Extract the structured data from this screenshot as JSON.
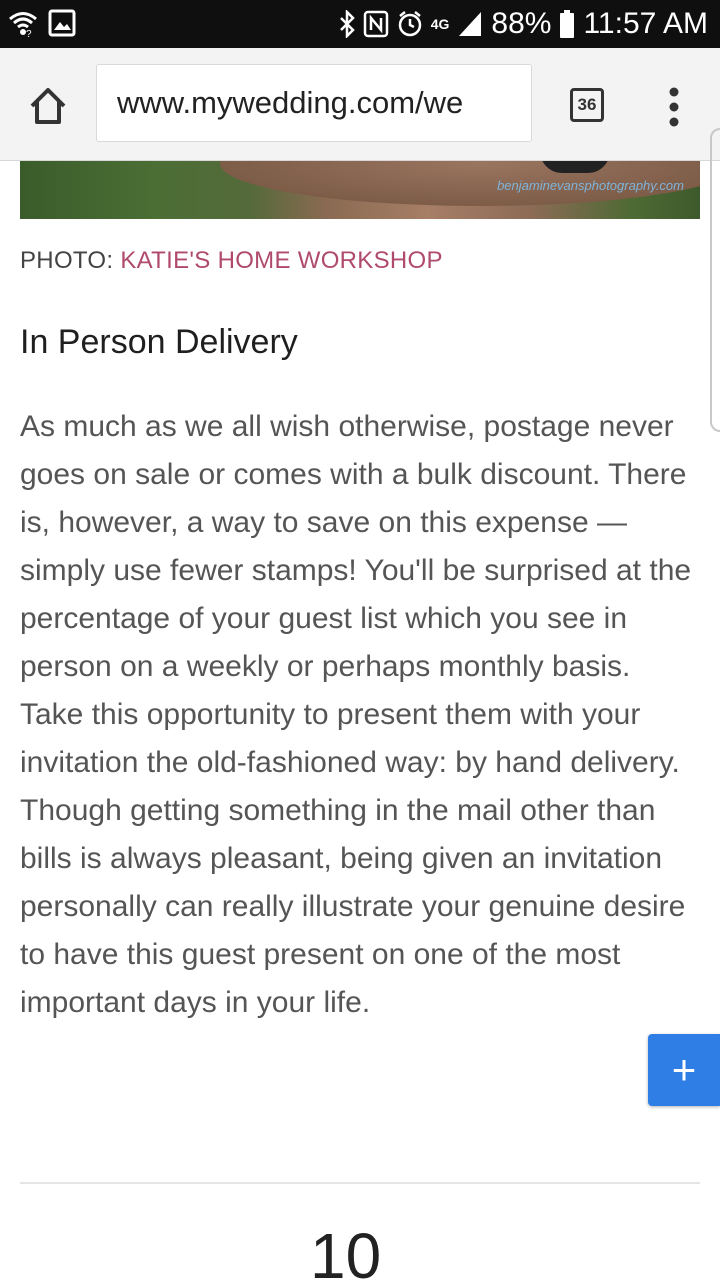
{
  "status_bar": {
    "battery": "88%",
    "time": "11:57 AM",
    "network": "4G",
    "icons": [
      "wifi-icon",
      "image-icon",
      "bluetooth-icon",
      "nfc-icon",
      "alarm-icon",
      "signal-icon",
      "battery-icon"
    ]
  },
  "browser": {
    "url": "www.mywedding.com/we",
    "tab_count": "36",
    "icons": [
      "home-icon",
      "more-vert-icon"
    ]
  },
  "article": {
    "photo_credit": "benjaminevansphotography.com",
    "caption_label": "PHOTO: ",
    "caption_link": "KATIE'S HOME WORKSHOP",
    "section_title": "In Person Delivery",
    "paragraph": "As much as we all wish otherwise, postage never goes on sale or comes with a bulk discount. There is, however, a way to save on this expense — simply use fewer stamps! You'll be surprised at the percentage of your guest list which you see in person on a weekly or perhaps monthly basis. Take this opportunity to present them with your invitation the old-fashioned way: by hand delivery. Though getting something in the mail other than bills is always pleasant, being given an invitation personally can really illustrate your genuine desire to have this guest present on one of the most important days in your life.",
    "next_number": "10"
  },
  "fab": {
    "label": "+",
    "icon": "plus-icon"
  },
  "colors": {
    "status_bar_bg": "#0f0f0f",
    "toolbar_bg": "#f3f3f3",
    "caption_link": "#b04a6d",
    "fab_bg": "#2f7ee6",
    "body_text": "#555555"
  }
}
